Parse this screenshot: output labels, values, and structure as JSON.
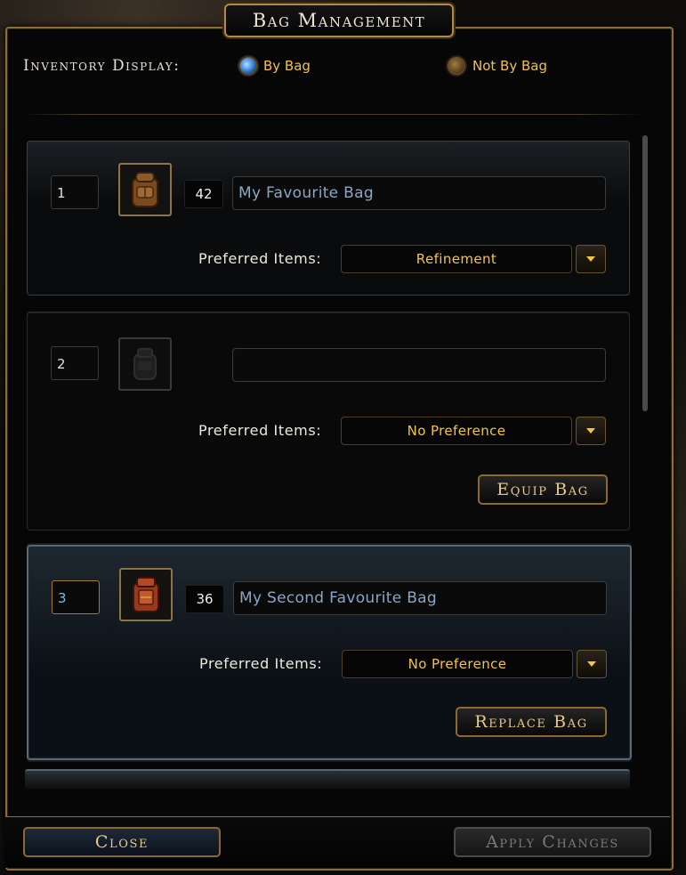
{
  "window": {
    "title": "Bag Management"
  },
  "display": {
    "label": "Inventory Display:",
    "options": [
      {
        "label": "By Bag",
        "selected": true
      },
      {
        "label": "Not By Bag",
        "selected": false
      }
    ]
  },
  "bags": [
    {
      "slot": "1",
      "count": "42",
      "name": "My Favourite Bag",
      "pref_label": "Preferred Items:",
      "pref_value": "Refinement",
      "icon": "brown-backpack-icon"
    },
    {
      "slot": "2",
      "count": "",
      "name": "",
      "pref_label": "Preferred Items:",
      "pref_value": "No Preference",
      "action": "Equip Bag",
      "icon": "empty-bag-silhouette-icon"
    },
    {
      "slot": "3",
      "count": "36",
      "name": "My Second Favourite Bag",
      "pref_label": "Preferred Items:",
      "pref_value": "No Preference",
      "action": "Replace Bag",
      "icon": "red-backpack-icon"
    }
  ],
  "footer": {
    "close": "Close",
    "apply": "Apply Changes"
  },
  "colors": {
    "gold": "#f2c446",
    "border": "#8c6d34",
    "name_text": "#8aa6c6",
    "radio_on": "#3d8de0"
  }
}
